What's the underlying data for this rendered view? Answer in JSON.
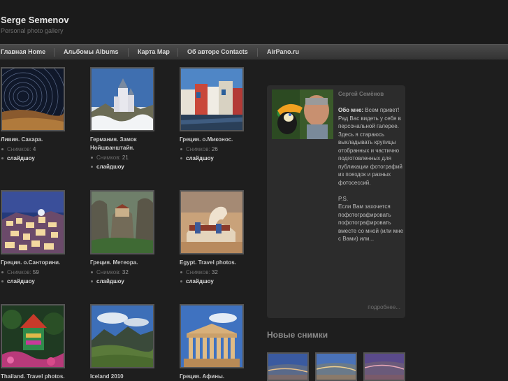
{
  "site": {
    "title": "Serge Semenov",
    "subtitle": "Personal photo gallery"
  },
  "nav": [
    {
      "label": "Главная Home"
    },
    {
      "label": "Альбомы Albums"
    },
    {
      "label": "Карта Map"
    },
    {
      "label": "Об авторе Contacts"
    },
    {
      "label": "AirPano.ru"
    }
  ],
  "albums": [
    {
      "title": "Ливия. Сахара.",
      "count_label": "Снимков:",
      "count": "4",
      "slideshow": "слайдшоу",
      "icon": "sahara-star-trails"
    },
    {
      "title": "Германия. Замок Нойшванштайн.",
      "count_label": "Снимков:",
      "count": "21",
      "slideshow": "слайдшоу",
      "icon": "neuschwanstein-castle"
    },
    {
      "title": "Греция. о.Миконос.",
      "count_label": "Снимков:",
      "count": "26",
      "slideshow": "слайдшоу",
      "icon": "mykonos-waterfront"
    },
    {
      "title": "Греция. о.Санторини.",
      "count_label": "Снимков:",
      "count": "59",
      "slideshow": "слайдшоу",
      "icon": "santorini-night"
    },
    {
      "title": "Греция. Метеора.",
      "count_label": "Снимков:",
      "count": "32",
      "slideshow": "слайдшоу",
      "icon": "meteora-monastery"
    },
    {
      "title": "Egypt. Travel photos.",
      "count_label": "Снимков:",
      "count": "32",
      "slideshow": "слайдшоу",
      "icon": "camel"
    },
    {
      "title": "Thailand. Travel photos.",
      "icon": "thai-temple"
    },
    {
      "title": "Iceland 2010",
      "icon": "iceland-landscape"
    },
    {
      "title": "Греция. Афины.",
      "icon": "parthenon"
    }
  ],
  "about": {
    "name": "Сергей Семёнов",
    "lead": "Обо мне:",
    "text": " Всем привет!\nРад Вас видеть у себя в персональной галерее.\nЗдесь я стараюсь выкладывать крупицы отобранных и частично подготовленных для публикации фотографий из поездок и разных фотосессий.\n\nP.S.\nЕсли Вам захочется пофотографировать пофотографировать вместе со мной (или мне с Вами) или...",
    "more": "подробнее...",
    "photo_icon": "toucan-portrait"
  },
  "recent": {
    "title": "Новые снимки",
    "items": [
      {
        "icon": "city-aerial-1"
      },
      {
        "icon": "city-aerial-2"
      },
      {
        "icon": "city-aerial-3"
      }
    ]
  }
}
